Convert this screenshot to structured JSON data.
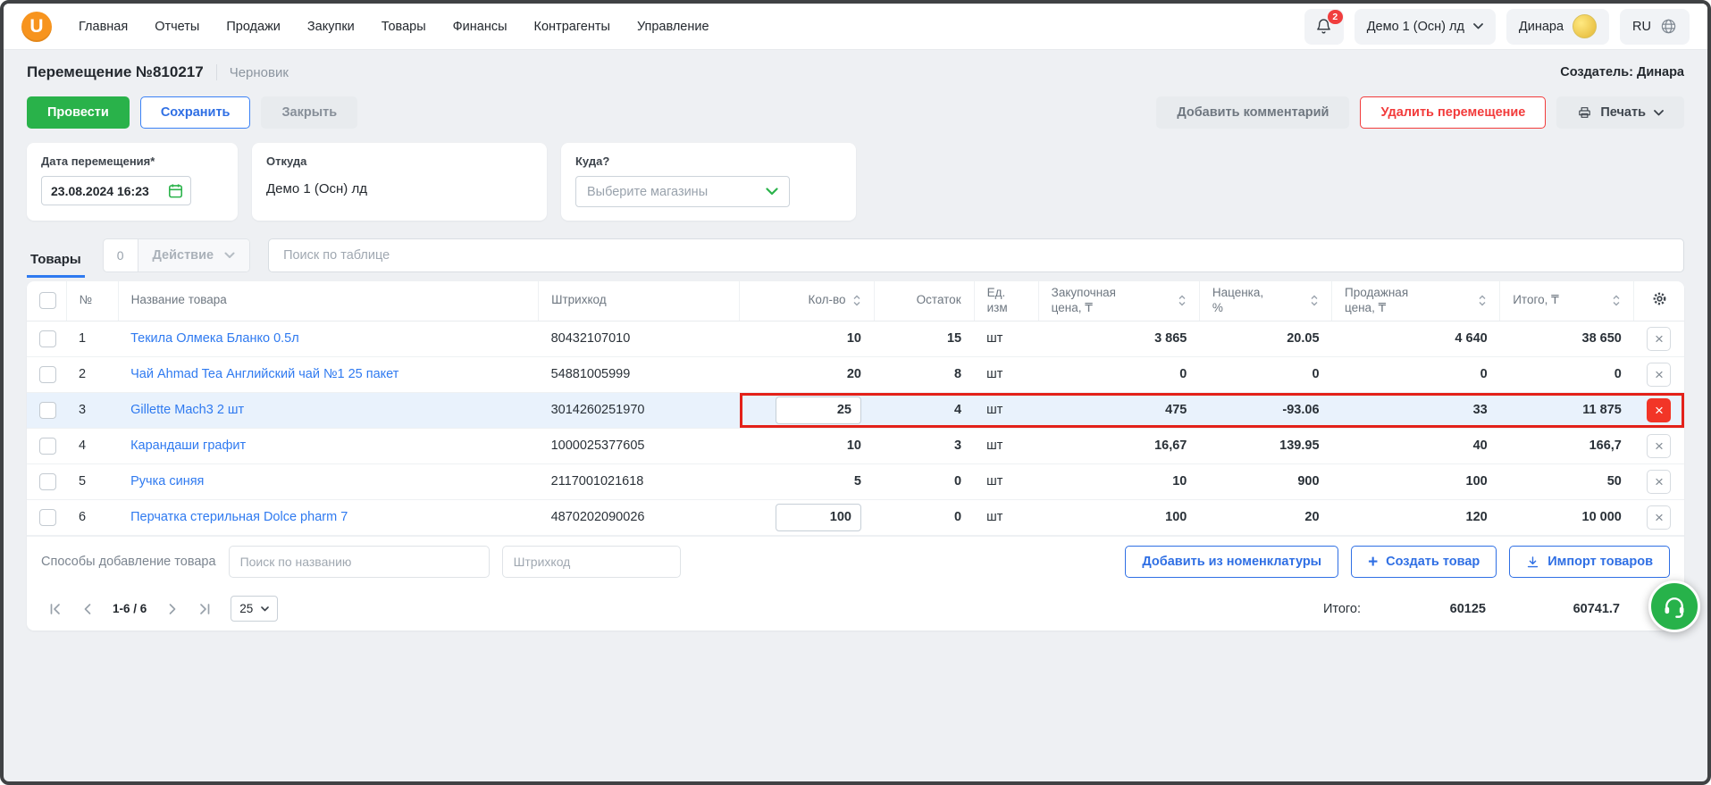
{
  "topnav": {
    "logo_letter": "U",
    "menu": [
      {
        "label": "Главная"
      },
      {
        "label": "Отчеты"
      },
      {
        "label": "Продажи"
      },
      {
        "label": "Закупки"
      },
      {
        "label": "Товары"
      },
      {
        "label": "Финансы"
      },
      {
        "label": "Контрагенты"
      },
      {
        "label": "Управление"
      }
    ],
    "notification_count": "2",
    "org_selector_value": "Демо 1 (Осн) лд",
    "user_name": "Динара",
    "language": "RU"
  },
  "page": {
    "title": "Перемещение №810217",
    "status": "Черновик",
    "creator": "Создатель: Динара"
  },
  "actions": {
    "post": "Провести",
    "save": "Сохранить",
    "close": "Закрыть",
    "add_comment": "Добавить комментарий",
    "delete": "Удалить перемещение",
    "print": "Печать"
  },
  "form": {
    "date": {
      "label": "Дата перемещения*",
      "value": "23.08.2024 16:23"
    },
    "from": {
      "label": "Откуда",
      "value": "Демо 1 (Осн) лд"
    },
    "to": {
      "label": "Куда?",
      "placeholder": "Выберите магазины"
    }
  },
  "toolbar": {
    "tab_products": "Товары",
    "selected_count": "0",
    "action_label": "Действие",
    "search_placeholder": "Поиск по таблице"
  },
  "table": {
    "headers": {
      "num": "№",
      "name": "Название товара",
      "barcode": "Штрихкод",
      "qty": "Кол-во",
      "stock": "Остаток",
      "unit": "Ед. изм",
      "purchase_price": "Закупочная цена, ₸",
      "markup": "Наценка, %",
      "sale_price": "Продажная цена, ₸",
      "total": "Итого, ₸"
    },
    "rows": [
      {
        "num": "1",
        "name": "Текила Олмека Бланко 0.5л",
        "barcode": "80432107010",
        "qty": "10",
        "stock": "15",
        "unit": "шт",
        "purchase_price": "3 865",
        "markup": "20.05",
        "sale_price": "4 640",
        "total": "38 650"
      },
      {
        "num": "2",
        "name": "Чай Ahmad Tea Английский чай №1 25 пакет",
        "barcode": "54881005999",
        "qty": "20",
        "stock": "8",
        "unit": "шт",
        "purchase_price": "0",
        "markup": "0",
        "sale_price": "0",
        "total": "0"
      },
      {
        "num": "3",
        "name": "Gillette Mach3 2 шт",
        "barcode": "3014260251970",
        "qty": "25",
        "stock": "4",
        "unit": "шт",
        "purchase_price": "475",
        "markup": "-93.06",
        "sale_price": "33",
        "total": "11 875"
      },
      {
        "num": "4",
        "name": "Карандаши графит",
        "barcode": "1000025377605",
        "qty": "10",
        "stock": "3",
        "unit": "шт",
        "purchase_price": "16,67",
        "markup": "139.95",
        "sale_price": "40",
        "total": "166,7"
      },
      {
        "num": "5",
        "name": "Ручка синяя",
        "barcode": "2117001021618",
        "qty": "5",
        "stock": "0",
        "unit": "шт",
        "purchase_price": "10",
        "markup": "900",
        "sale_price": "100",
        "total": "50"
      },
      {
        "num": "6",
        "name": "Перчатка стерильная Dolce pharm 7",
        "barcode": "4870202090026",
        "qty": "100",
        "stock": "0",
        "unit": "шт",
        "purchase_price": "100",
        "markup": "20",
        "sale_price": "120",
        "total": "10 000"
      }
    ]
  },
  "add_panel": {
    "label": "Способы добавление товара",
    "search_name_placeholder": "Поиск по названию",
    "barcode_placeholder": "Штрихкод",
    "add_from_nomenclature": "Добавить из номенклатуры",
    "create_product": "Создать товар",
    "import_products": "Импорт товаров"
  },
  "pagination": {
    "range": "1-6 / 6",
    "page_size": "25",
    "totals_label": "Итого:",
    "total_sale": "60125",
    "total_overall": "60741.7"
  },
  "icons": {
    "close": "×",
    "plus": "+"
  },
  "colors": {
    "accent_green": "#29b24a",
    "accent_blue": "#2f6fe4",
    "accent_red": "#f23b3b",
    "annotation_red": "#e32119",
    "logo_orange": "#f7941e"
  }
}
